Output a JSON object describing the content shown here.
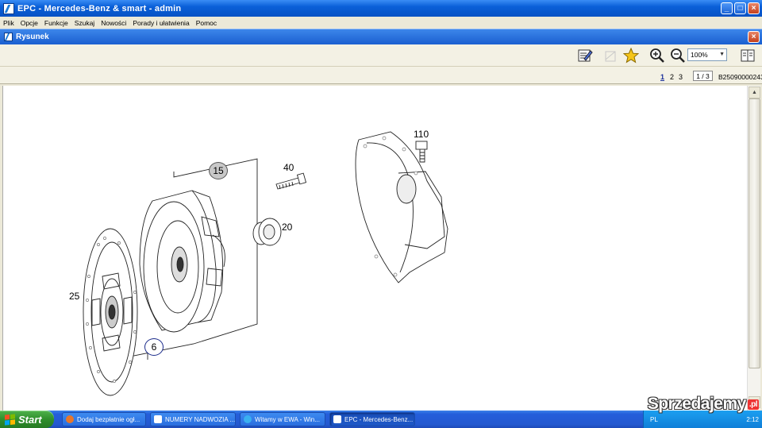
{
  "window": {
    "title": "EPC - Mercedes-Benz & smart - admin",
    "buttons": {
      "minimize": "_",
      "maximize": "□",
      "close": "×"
    }
  },
  "menu": [
    "Plik",
    "Opcje",
    "Funkcje",
    "Szukaj",
    "Nowości",
    "Porady i ułatwienia",
    "Pomoc"
  ],
  "child_window": {
    "title": "Rysunek",
    "close": "×"
  },
  "toolbar": {
    "icons": [
      "edit-list-icon",
      "disabled-tool-icon",
      "star-icon",
      "zoom-in-icon",
      "zoom-out-icon",
      "book-icon"
    ],
    "zoom": "100%"
  },
  "pager": {
    "pages": [
      "1",
      "2",
      "3"
    ],
    "active": "1",
    "position": "1 / 3",
    "doc_id": "B25090000243"
  },
  "drawing": {
    "callouts": [
      "15",
      "40",
      "110",
      "20",
      "25",
      "6"
    ]
  },
  "taskbar": {
    "start": "Start",
    "tasks": [
      {
        "label": "Dodaj bezpłatnie ogł...",
        "color": "#e8762b"
      },
      {
        "label": "NUMERY NADWOZIA ...",
        "color": "#ffffff"
      },
      {
        "label": "Witamy w EWA - Win...",
        "color": "#3ab0f0"
      },
      {
        "label": "EPC - Mercedes-Benz...",
        "color": "#ffffff"
      }
    ],
    "tray": {
      "lang": "PL",
      "clock": "2:12"
    }
  },
  "watermark": {
    "name": "Sprzedajemy",
    "tld": ".pl"
  }
}
